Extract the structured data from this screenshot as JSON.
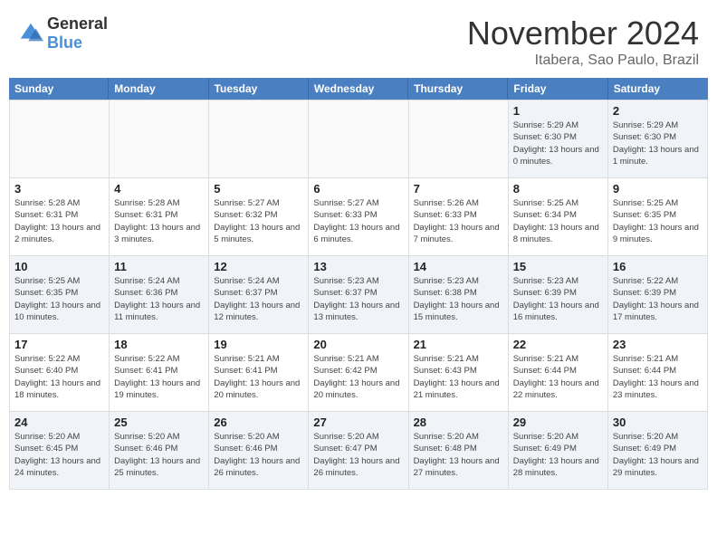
{
  "header": {
    "logo_general": "General",
    "logo_blue": "Blue",
    "month_title": "November 2024",
    "location": "Itabera, Sao Paulo, Brazil"
  },
  "calendar": {
    "days_of_week": [
      "Sunday",
      "Monday",
      "Tuesday",
      "Wednesday",
      "Thursday",
      "Friday",
      "Saturday"
    ],
    "weeks": [
      [
        {
          "day": "",
          "info": "",
          "empty": true
        },
        {
          "day": "",
          "info": "",
          "empty": true
        },
        {
          "day": "",
          "info": "",
          "empty": true
        },
        {
          "day": "",
          "info": "",
          "empty": true
        },
        {
          "day": "",
          "info": "",
          "empty": true
        },
        {
          "day": "1",
          "info": "Sunrise: 5:29 AM\nSunset: 6:30 PM\nDaylight: 13 hours and 0 minutes."
        },
        {
          "day": "2",
          "info": "Sunrise: 5:29 AM\nSunset: 6:30 PM\nDaylight: 13 hours and 1 minute."
        }
      ],
      [
        {
          "day": "3",
          "info": "Sunrise: 5:28 AM\nSunset: 6:31 PM\nDaylight: 13 hours and 2 minutes."
        },
        {
          "day": "4",
          "info": "Sunrise: 5:28 AM\nSunset: 6:31 PM\nDaylight: 13 hours and 3 minutes."
        },
        {
          "day": "5",
          "info": "Sunrise: 5:27 AM\nSunset: 6:32 PM\nDaylight: 13 hours and 5 minutes."
        },
        {
          "day": "6",
          "info": "Sunrise: 5:27 AM\nSunset: 6:33 PM\nDaylight: 13 hours and 6 minutes."
        },
        {
          "day": "7",
          "info": "Sunrise: 5:26 AM\nSunset: 6:33 PM\nDaylight: 13 hours and 7 minutes."
        },
        {
          "day": "8",
          "info": "Sunrise: 5:25 AM\nSunset: 6:34 PM\nDaylight: 13 hours and 8 minutes."
        },
        {
          "day": "9",
          "info": "Sunrise: 5:25 AM\nSunset: 6:35 PM\nDaylight: 13 hours and 9 minutes."
        }
      ],
      [
        {
          "day": "10",
          "info": "Sunrise: 5:25 AM\nSunset: 6:35 PM\nDaylight: 13 hours and 10 minutes."
        },
        {
          "day": "11",
          "info": "Sunrise: 5:24 AM\nSunset: 6:36 PM\nDaylight: 13 hours and 11 minutes."
        },
        {
          "day": "12",
          "info": "Sunrise: 5:24 AM\nSunset: 6:37 PM\nDaylight: 13 hours and 12 minutes."
        },
        {
          "day": "13",
          "info": "Sunrise: 5:23 AM\nSunset: 6:37 PM\nDaylight: 13 hours and 13 minutes."
        },
        {
          "day": "14",
          "info": "Sunrise: 5:23 AM\nSunset: 6:38 PM\nDaylight: 13 hours and 15 minutes."
        },
        {
          "day": "15",
          "info": "Sunrise: 5:23 AM\nSunset: 6:39 PM\nDaylight: 13 hours and 16 minutes."
        },
        {
          "day": "16",
          "info": "Sunrise: 5:22 AM\nSunset: 6:39 PM\nDaylight: 13 hours and 17 minutes."
        }
      ],
      [
        {
          "day": "17",
          "info": "Sunrise: 5:22 AM\nSunset: 6:40 PM\nDaylight: 13 hours and 18 minutes."
        },
        {
          "day": "18",
          "info": "Sunrise: 5:22 AM\nSunset: 6:41 PM\nDaylight: 13 hours and 19 minutes."
        },
        {
          "day": "19",
          "info": "Sunrise: 5:21 AM\nSunset: 6:41 PM\nDaylight: 13 hours and 20 minutes."
        },
        {
          "day": "20",
          "info": "Sunrise: 5:21 AM\nSunset: 6:42 PM\nDaylight: 13 hours and 20 minutes."
        },
        {
          "day": "21",
          "info": "Sunrise: 5:21 AM\nSunset: 6:43 PM\nDaylight: 13 hours and 21 minutes."
        },
        {
          "day": "22",
          "info": "Sunrise: 5:21 AM\nSunset: 6:44 PM\nDaylight: 13 hours and 22 minutes."
        },
        {
          "day": "23",
          "info": "Sunrise: 5:21 AM\nSunset: 6:44 PM\nDaylight: 13 hours and 23 minutes."
        }
      ],
      [
        {
          "day": "24",
          "info": "Sunrise: 5:20 AM\nSunset: 6:45 PM\nDaylight: 13 hours and 24 minutes."
        },
        {
          "day": "25",
          "info": "Sunrise: 5:20 AM\nSunset: 6:46 PM\nDaylight: 13 hours and 25 minutes."
        },
        {
          "day": "26",
          "info": "Sunrise: 5:20 AM\nSunset: 6:46 PM\nDaylight: 13 hours and 26 minutes."
        },
        {
          "day": "27",
          "info": "Sunrise: 5:20 AM\nSunset: 6:47 PM\nDaylight: 13 hours and 26 minutes."
        },
        {
          "day": "28",
          "info": "Sunrise: 5:20 AM\nSunset: 6:48 PM\nDaylight: 13 hours and 27 minutes."
        },
        {
          "day": "29",
          "info": "Sunrise: 5:20 AM\nSunset: 6:49 PM\nDaylight: 13 hours and 28 minutes."
        },
        {
          "day": "30",
          "info": "Sunrise: 5:20 AM\nSunset: 6:49 PM\nDaylight: 13 hours and 29 minutes."
        }
      ]
    ]
  }
}
